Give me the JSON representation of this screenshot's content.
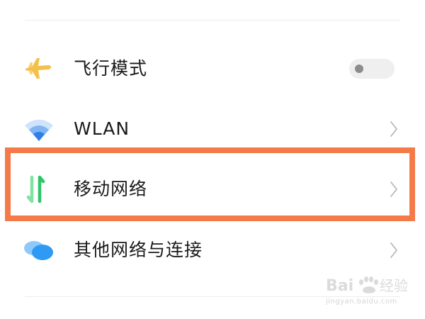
{
  "settings": {
    "rows": [
      {
        "label": "飞行模式",
        "icon": "airplane-icon",
        "control": "toggle",
        "toggle_on": false,
        "icon_color": "#f5c04a"
      },
      {
        "label": "WLAN",
        "icon": "wifi-icon",
        "control": "chevron",
        "icon_color": "#3b8cf0"
      },
      {
        "label": "移动网络",
        "icon": "mobile-data-icon",
        "control": "chevron",
        "icon_color": "#3ccf6e"
      },
      {
        "label": "其他网络与连接",
        "icon": "cloud-connections-icon",
        "control": "chevron",
        "icon_color": "#3aa0f5"
      }
    ]
  },
  "highlight": {
    "color": "#f47a4a",
    "target": "移动网络"
  },
  "watermark": {
    "brand": "Baidu经验",
    "url": "jingyan.baidu.com"
  }
}
